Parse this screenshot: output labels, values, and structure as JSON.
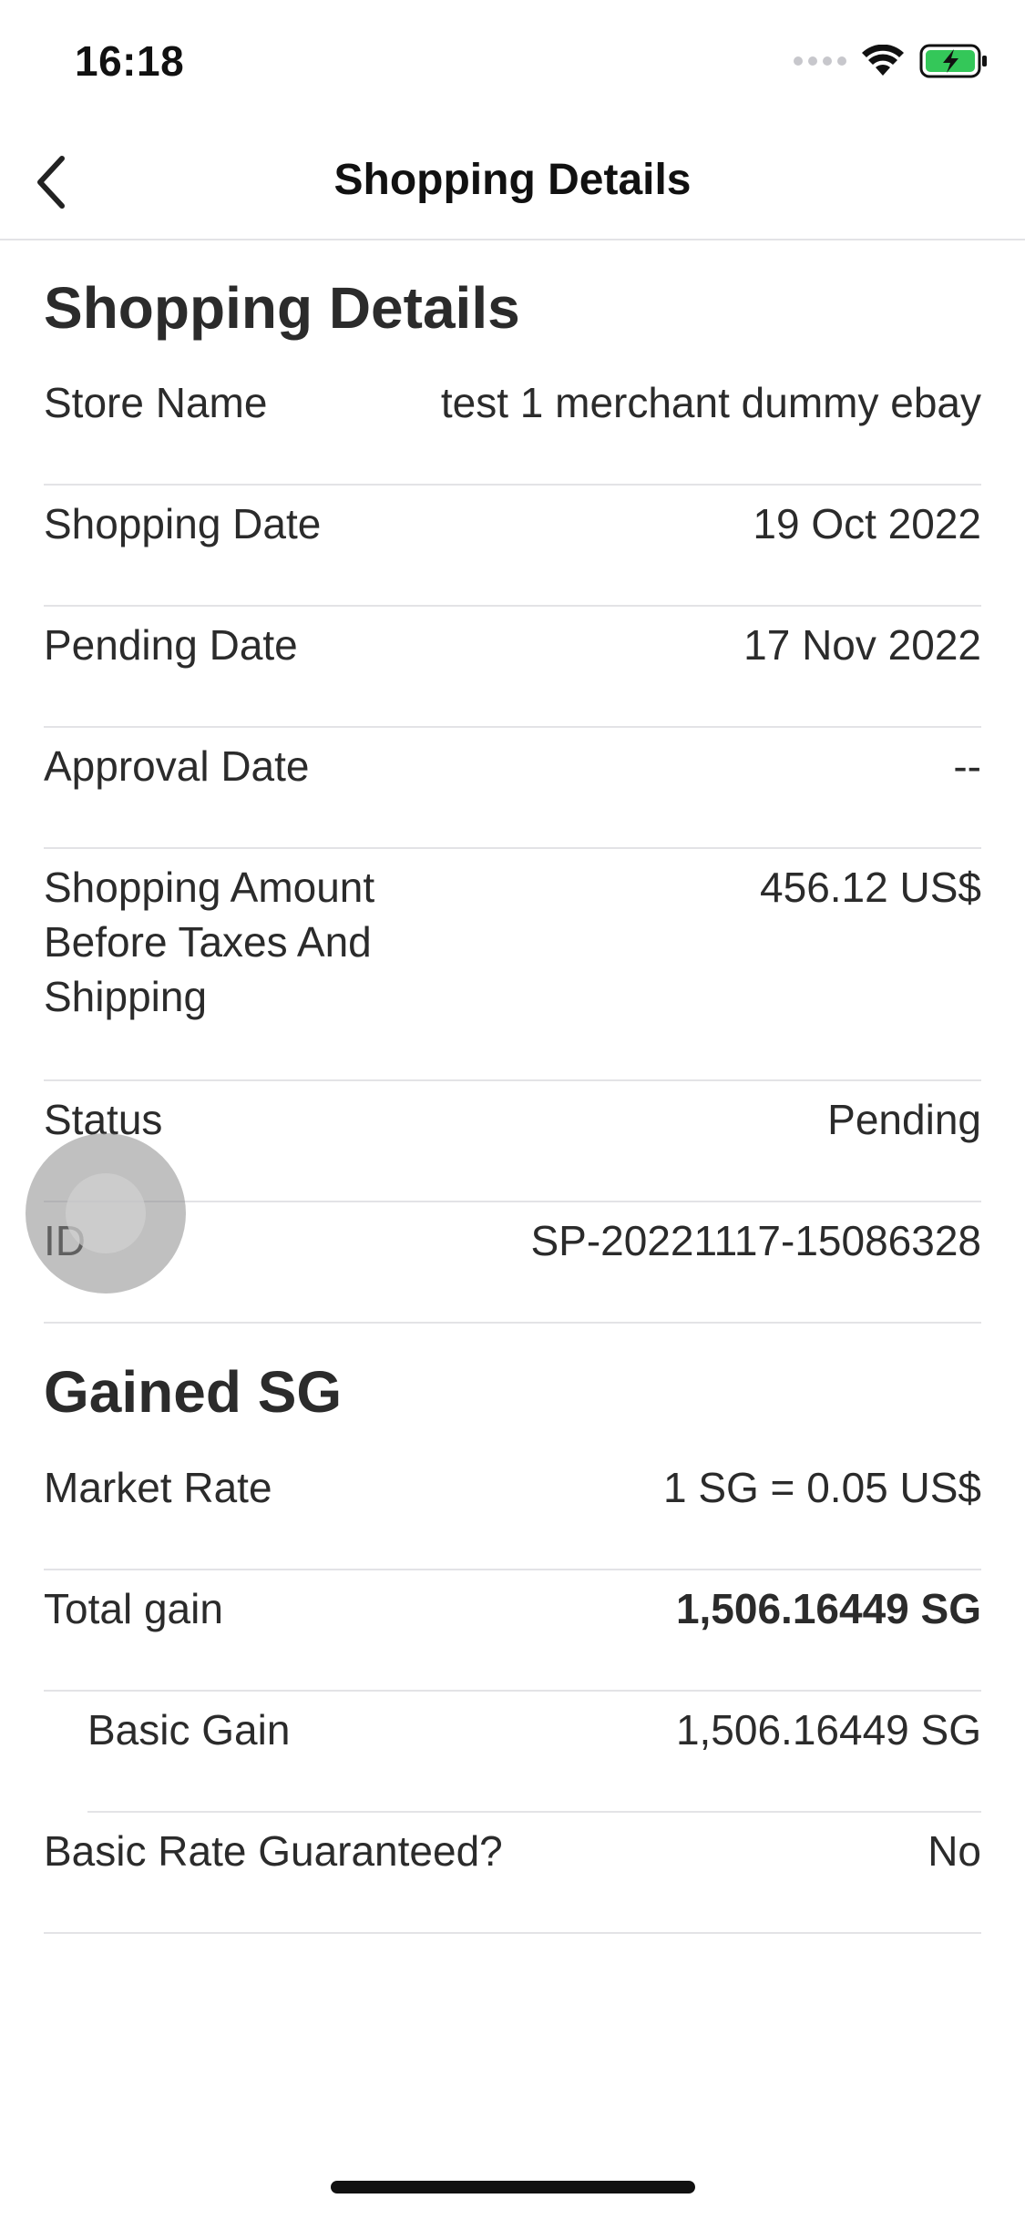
{
  "status_bar": {
    "time": "16:18",
    "battery_color": "#34c759"
  },
  "nav": {
    "back_icon": "chevron-left-icon",
    "title": "Shopping Details"
  },
  "shopping_section": {
    "title": "Shopping Details",
    "rows": [
      {
        "label": "Store Name",
        "value": "test 1 merchant dummy ebay"
      },
      {
        "label": "Shopping Date",
        "value": "19 Oct 2022"
      },
      {
        "label": "Pending Date",
        "value": "17 Nov 2022"
      },
      {
        "label": "Approval Date",
        "value": "--"
      },
      {
        "label": "Shopping Amount Before Taxes And Shipping",
        "value": "456.12 US$"
      },
      {
        "label": "Status",
        "value": "Pending"
      },
      {
        "label": "ID",
        "value": "SP-20221117-15086328"
      }
    ]
  },
  "gained_section": {
    "title": "Gained SG",
    "rows": [
      {
        "label": "Market Rate",
        "value": "1 SG = 0.05 US$"
      },
      {
        "label": "Total gain",
        "value": "1,506.16449 SG"
      },
      {
        "label": "Basic Gain",
        "value": "1,506.16449 SG"
      },
      {
        "label": "Basic Rate Guaranteed?",
        "value": "No"
      }
    ]
  }
}
